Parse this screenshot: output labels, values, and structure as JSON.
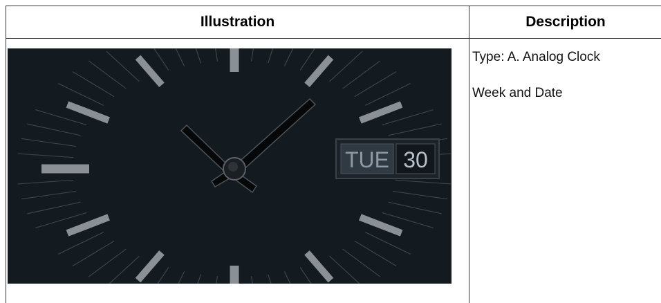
{
  "table": {
    "headers": {
      "illustration": "Illustration",
      "description": "Description"
    }
  },
  "clock": {
    "type_text": "Type: A. Analog Clock",
    "feature_text": "Week and Date",
    "date_window": {
      "day": "TUE",
      "date": "30"
    },
    "colors": {
      "face": "#131a20",
      "hour_marker": "#8a9096",
      "minute_tick": "#3d444b",
      "hand": "#050708",
      "hand_edge": "#565c62"
    }
  }
}
